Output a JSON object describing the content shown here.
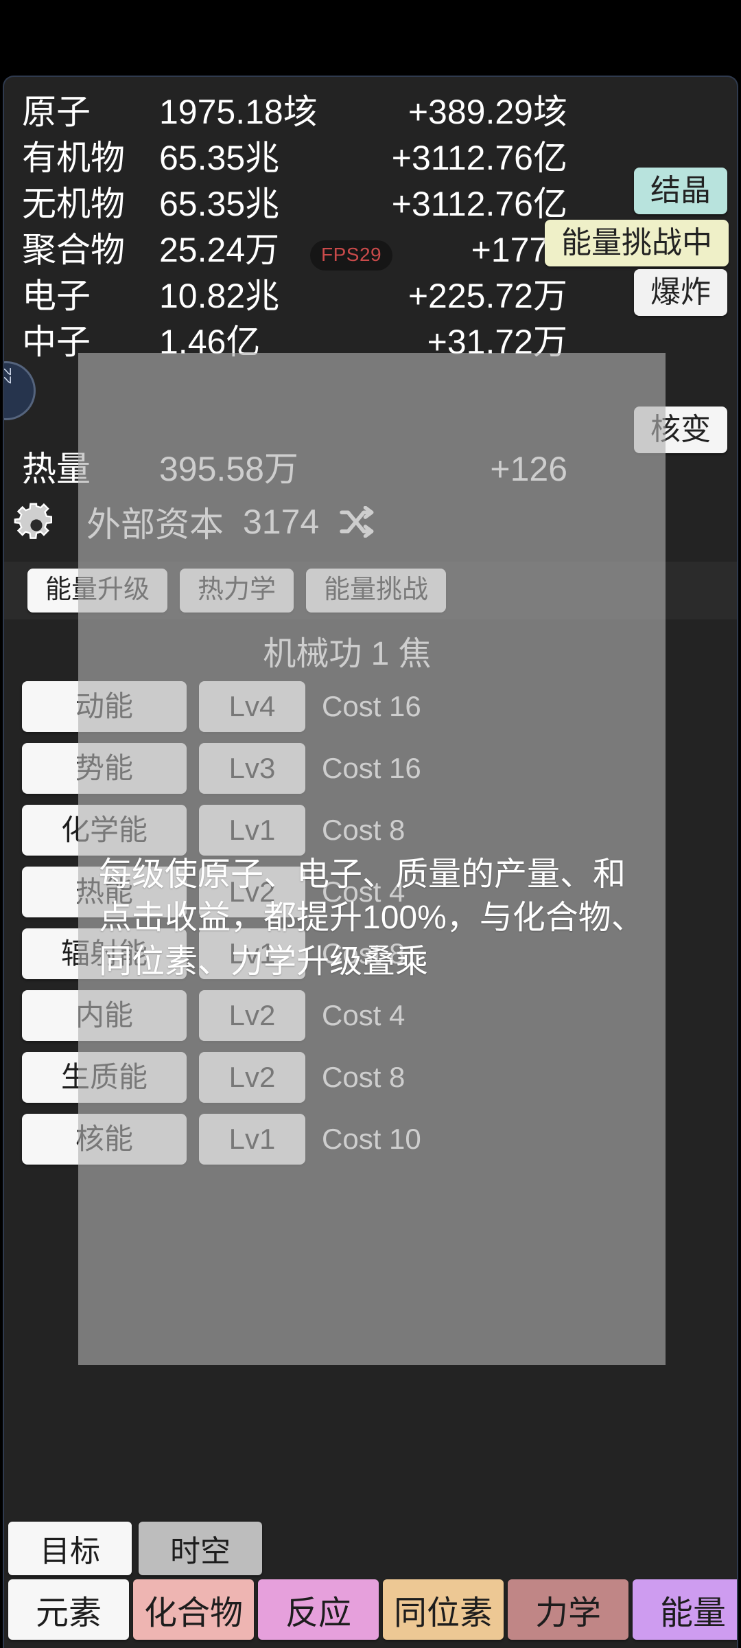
{
  "app": {
    "fps_badge": "FPS29",
    "left_badge": "22"
  },
  "resources": {
    "columns": [
      "name",
      "amount",
      "rate"
    ],
    "rows": [
      {
        "name": "原子",
        "amount": "1975.18垓",
        "rate": "+389.29垓"
      },
      {
        "name": "有机物",
        "amount": "65.35兆",
        "rate": "+3112.76亿"
      },
      {
        "name": "无机物",
        "amount": "65.35兆",
        "rate": "+3112.76亿"
      },
      {
        "name": "聚合物",
        "amount": "25.24万",
        "rate": "+1770"
      },
      {
        "name": "电子",
        "amount": "10.82兆",
        "rate": "+225.72万"
      },
      {
        "name": "中子",
        "amount": "1.46亿",
        "rate": "+31.72万"
      },
      {
        "name": "热量",
        "amount": "395.58万",
        "rate": "+126"
      }
    ],
    "capital": {
      "label": "外部资本",
      "value": "3174",
      "icon": "shuffle-icon"
    },
    "settings_icon": "gear-icon"
  },
  "side_buttons": [
    {
      "label": "结晶",
      "color": "#b8e3dd"
    },
    {
      "label": "能量挑战中",
      "color": "#eff0c8"
    },
    {
      "label": "爆炸",
      "color": "#f2f2f2"
    },
    {
      "label": "核变",
      "color": "#f5f5f5"
    }
  ],
  "tabs": [
    {
      "label": "能量升级",
      "active": true
    },
    {
      "label": "热力学",
      "active": false
    },
    {
      "label": "能量挑战",
      "active": false
    }
  ],
  "section": {
    "title": "机械功 1 焦"
  },
  "upgrades": [
    {
      "name": "动能",
      "level": "Lv4",
      "cost": "Cost 16"
    },
    {
      "name": "势能",
      "level": "Lv3",
      "cost": "Cost 16"
    },
    {
      "name": "化学能",
      "level": "Lv1",
      "cost": "Cost 8"
    },
    {
      "name": "热能",
      "level": "Lv2",
      "cost": "Cost 4"
    },
    {
      "name": "辐射能",
      "level": "Lv1",
      "cost": "Cost 8"
    },
    {
      "name": "内能",
      "level": "Lv2",
      "cost": "Cost 4"
    },
    {
      "name": "生质能",
      "level": "Lv2",
      "cost": "Cost 8"
    },
    {
      "name": "核能",
      "level": "Lv1",
      "cost": "Cost 10"
    }
  ],
  "tooltip": {
    "text": "每级使原子、电子、质量的产量、和点击收益，都提升100%，与化合物、同位素、力学升级叠乘"
  },
  "nav_top": [
    {
      "label": "目标",
      "color": "#f7f7f7"
    },
    {
      "label": "时空",
      "color": "#bdbdbd"
    }
  ],
  "nav_bottom": [
    {
      "label": "元素",
      "color": "#f7f7f7"
    },
    {
      "label": "化合物",
      "color": "#eeb5b2"
    },
    {
      "label": "反应",
      "color": "#e6a0dc"
    },
    {
      "label": "同位素",
      "color": "#edc894"
    },
    {
      "label": "力学",
      "color": "#c08686"
    },
    {
      "label": "能量",
      "color": "#ce9cf0"
    }
  ]
}
